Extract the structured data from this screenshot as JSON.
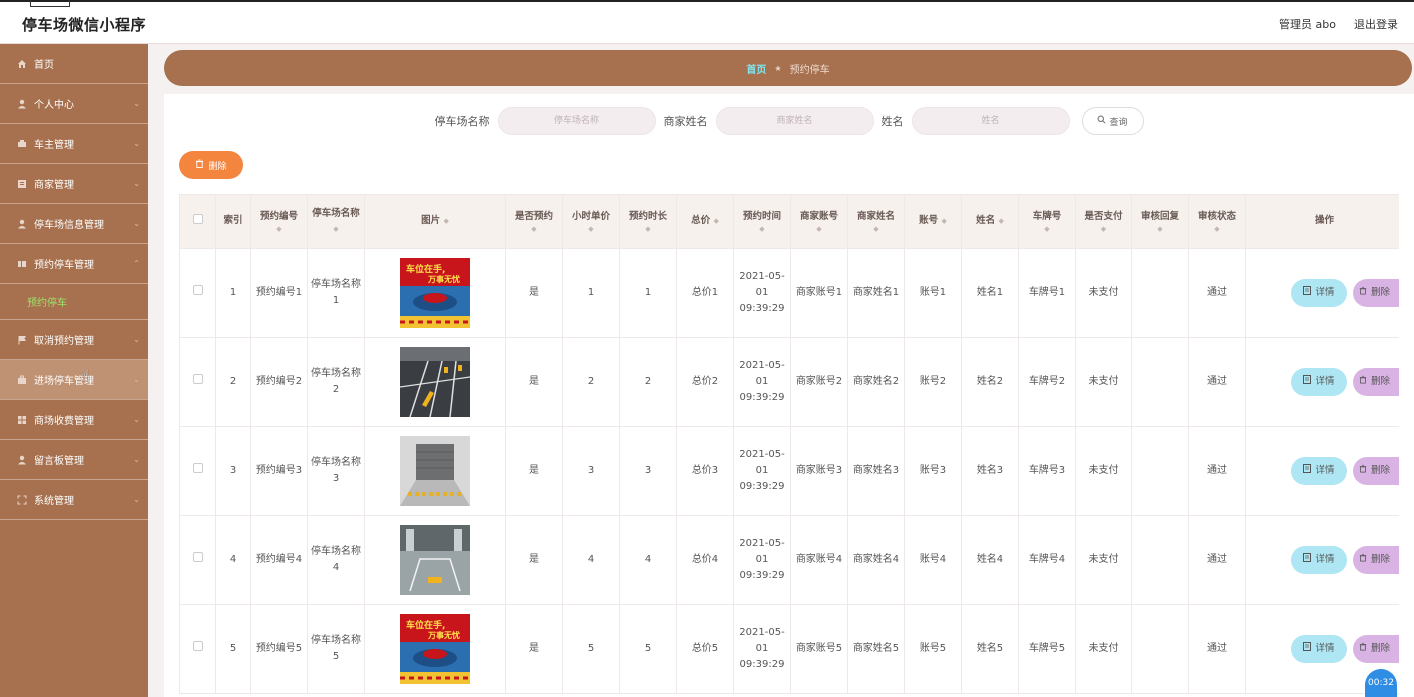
{
  "header": {
    "app_title": "停车场微信小程序",
    "user": "管理员 abo",
    "logout": "退出登录"
  },
  "sidebar": {
    "items": [
      {
        "label": "首页",
        "icon": "home-icon"
      },
      {
        "label": "个人中心",
        "icon": "user-icon"
      },
      {
        "label": "车主管理",
        "icon": "car-icon"
      },
      {
        "label": "商家管理",
        "icon": "store-icon"
      },
      {
        "label": "停车场信息管理",
        "icon": "user-icon"
      },
      {
        "label": "预约停车管理",
        "icon": "grid-icon"
      },
      {
        "label": "取消预约管理",
        "icon": "flag-icon"
      },
      {
        "label": "进场停车管理",
        "icon": "briefcase-icon"
      },
      {
        "label": "商场收费管理",
        "icon": "grid-icon"
      },
      {
        "label": "留言板管理",
        "icon": "user-icon"
      },
      {
        "label": "系统管理",
        "icon": "expand-icon"
      }
    ],
    "active_sub": "预约停车"
  },
  "breadcrumb": {
    "home": "首页",
    "current": "预约停车"
  },
  "search": {
    "field1_label": "停车场名称",
    "field1_placeholder": "停车场名称",
    "field2_label": "商家姓名",
    "field2_placeholder": "商家姓名",
    "field3_label": "姓名",
    "field3_placeholder": "姓名",
    "query_label": "查询"
  },
  "toolbar": {
    "delete_label": "删除"
  },
  "table": {
    "headers": {
      "index": "索引",
      "booking_no": "预约编号",
      "lot_name": "停车场名称",
      "image": "图片",
      "is_booked": "是否预约",
      "hour_price": "小时单价",
      "duration": "预约时长",
      "total": "总价",
      "book_time": "预约时间",
      "merchant_account": "商家账号",
      "merchant_name": "商家姓名",
      "account": "账号",
      "name": "姓名",
      "plate": "车牌号",
      "paid": "是否支付",
      "review_reply": "审核回复",
      "review_status": "审核状态",
      "actions": "操作"
    },
    "detail_label": "详情",
    "delete_label": "删除",
    "rows": [
      {
        "index": "1",
        "booking_no": "预约编号1",
        "lot_name": "停车场名称1",
        "image": "banner",
        "is_booked": "是",
        "hour_price": "1",
        "duration": "1",
        "total": "总价1",
        "book_time": "2021-05-01 09:39:29",
        "merchant_account": "商家账号1",
        "merchant_name": "商家姓名1",
        "account": "账号1",
        "name": "姓名1",
        "plate": "车牌号1",
        "paid": "未支付",
        "review_reply": "",
        "review_status": "通过"
      },
      {
        "index": "2",
        "booking_no": "预约编号2",
        "lot_name": "停车场名称2",
        "image": "lot",
        "is_booked": "是",
        "hour_price": "2",
        "duration": "2",
        "total": "总价2",
        "book_time": "2021-05-01 09:39:29",
        "merchant_account": "商家账号2",
        "merchant_name": "商家姓名2",
        "account": "账号2",
        "name": "姓名2",
        "plate": "车牌号2",
        "paid": "未支付",
        "review_reply": "",
        "review_status": "通过"
      },
      {
        "index": "3",
        "booking_no": "预约编号3",
        "lot_name": "停车场名称3",
        "image": "garage",
        "is_booked": "是",
        "hour_price": "3",
        "duration": "3",
        "total": "总价3",
        "book_time": "2021-05-01 09:39:29",
        "merchant_account": "商家账号3",
        "merchant_name": "商家姓名3",
        "account": "账号3",
        "name": "姓名3",
        "plate": "车牌号3",
        "paid": "未支付",
        "review_reply": "",
        "review_status": "通过"
      },
      {
        "index": "4",
        "booking_no": "预约编号4",
        "lot_name": "停车场名称4",
        "image": "underground",
        "is_booked": "是",
        "hour_price": "4",
        "duration": "4",
        "total": "总价4",
        "book_time": "2021-05-01 09:39:29",
        "merchant_account": "商家账号4",
        "merchant_name": "商家姓名4",
        "account": "账号4",
        "name": "姓名4",
        "plate": "车牌号4",
        "paid": "未支付",
        "review_reply": "",
        "review_status": "通过"
      },
      {
        "index": "5",
        "booking_no": "预约编号5",
        "lot_name": "停车场名称5",
        "image": "banner",
        "is_booked": "是",
        "hour_price": "5",
        "duration": "5",
        "total": "总价5",
        "book_time": "2021-05-01 09:39:29",
        "merchant_account": "商家账号5",
        "merchant_name": "商家姓名5",
        "account": "账号5",
        "name": "姓名5",
        "plate": "车牌号5",
        "paid": "未支付",
        "review_reply": "",
        "review_status": "通过"
      }
    ]
  },
  "banner_text": {
    "line1": "车位在手,",
    "line2": "万事无忧"
  },
  "timer": "00:32",
  "colors": {
    "sidebar": "#a7714f",
    "accent_orange": "#f4853f",
    "detail_button": "#aee7f3",
    "delete_button": "#d9b3e3",
    "active_sub": "#9ee36a"
  }
}
